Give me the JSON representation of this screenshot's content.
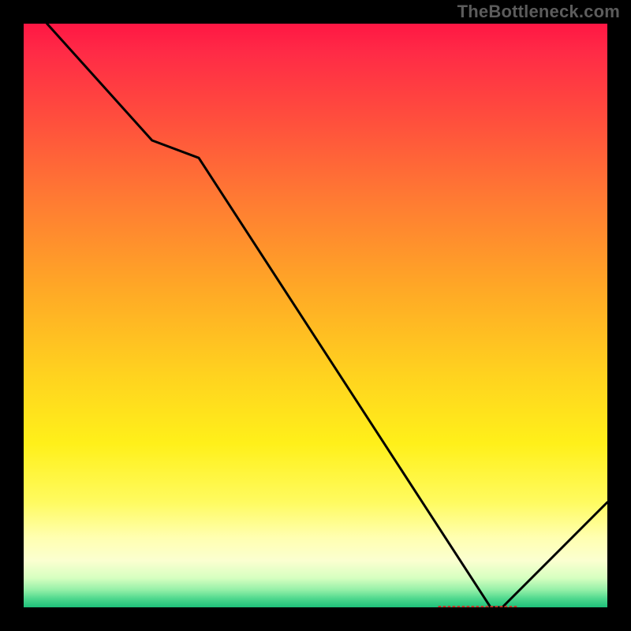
{
  "watermark": "TheBottleneck.com",
  "chart_data": {
    "type": "line",
    "title": "",
    "xlabel": "",
    "ylabel": "",
    "xlim": [
      0,
      100
    ],
    "ylim": [
      0,
      100
    ],
    "x": [
      4,
      22,
      30,
      80,
      82,
      100
    ],
    "values": [
      100,
      80,
      77,
      0,
      0,
      18
    ],
    "min_marker": {
      "x_start": 71,
      "x_end": 84,
      "y": 0,
      "label": ""
    },
    "gradient_stops": [
      {
        "offset": 0.0,
        "color": "#ff1744"
      },
      {
        "offset": 0.05,
        "color": "#ff2b46"
      },
      {
        "offset": 0.15,
        "color": "#ff4a3e"
      },
      {
        "offset": 0.3,
        "color": "#ff7a33"
      },
      {
        "offset": 0.45,
        "color": "#ffa726"
      },
      {
        "offset": 0.6,
        "color": "#ffd21f"
      },
      {
        "offset": 0.72,
        "color": "#fff01a"
      },
      {
        "offset": 0.82,
        "color": "#fffb60"
      },
      {
        "offset": 0.88,
        "color": "#ffffb0"
      },
      {
        "offset": 0.92,
        "color": "#fbffd0"
      },
      {
        "offset": 0.95,
        "color": "#d6ffc0"
      },
      {
        "offset": 0.97,
        "color": "#95f0a8"
      },
      {
        "offset": 0.985,
        "color": "#4fd88e"
      },
      {
        "offset": 1.0,
        "color": "#1ec079"
      }
    ]
  }
}
